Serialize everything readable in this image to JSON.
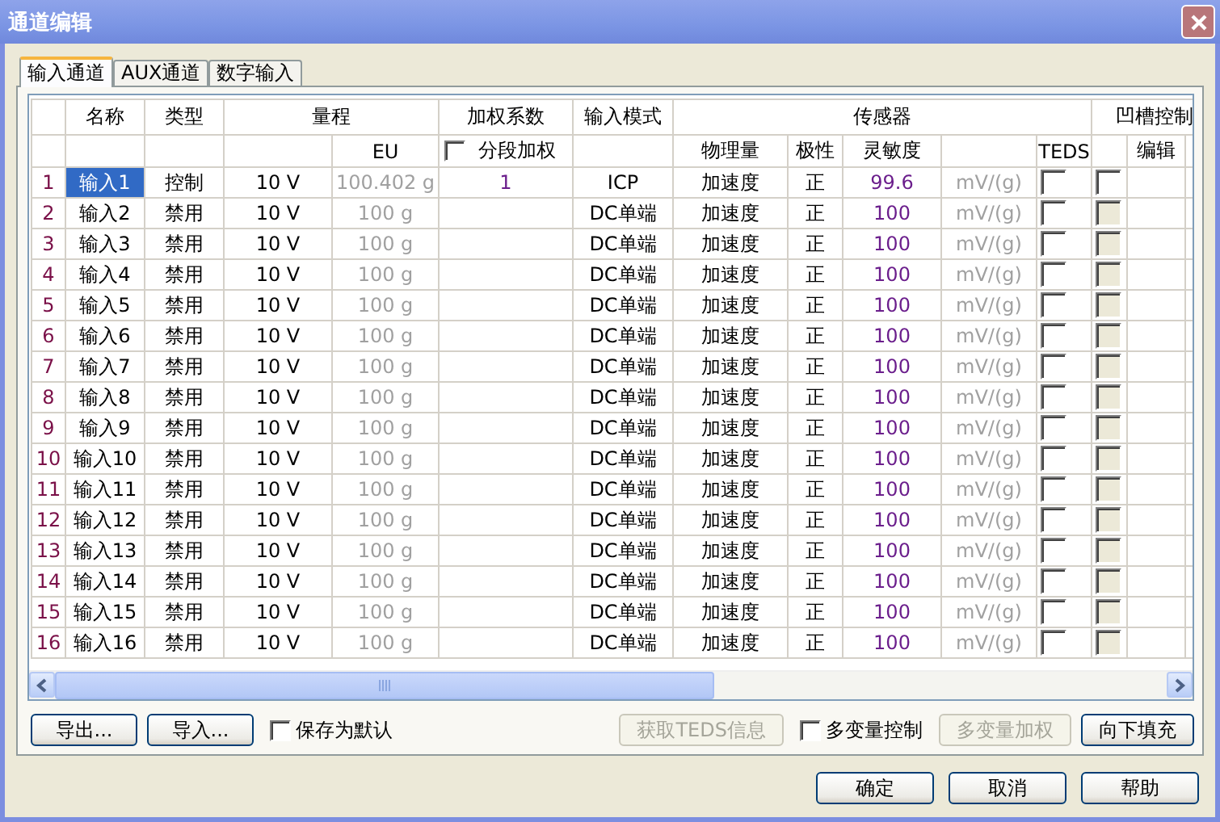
{
  "window": {
    "title": "通道编辑"
  },
  "tabs": [
    {
      "label": "输入通道",
      "selected": true
    },
    {
      "label": "AUX通道",
      "selected": false
    },
    {
      "label": "数字输入",
      "selected": false
    }
  ],
  "table": {
    "column_groups": [
      {
        "label": "名称",
        "subheaders": [
          {
            "kind": "blank"
          }
        ]
      },
      {
        "label": "类型",
        "subheaders": [
          {
            "kind": "blank"
          }
        ]
      },
      {
        "label": "量程",
        "subheaders": [
          {
            "kind": "blank"
          },
          {
            "kind": "text",
            "label": "EU"
          }
        ]
      },
      {
        "label": "加权系数",
        "subheaders": [
          {
            "kind": "checkbox",
            "label": "分段加权",
            "checked": false
          }
        ]
      },
      {
        "label": "输入模式",
        "subheaders": [
          {
            "kind": "blank"
          }
        ]
      },
      {
        "label": "传感器",
        "subheaders": [
          {
            "kind": "text",
            "label": "物理量"
          },
          {
            "kind": "text",
            "label": "极性"
          },
          {
            "kind": "text",
            "label": "灵敏度"
          },
          {
            "kind": "blank"
          },
          {
            "kind": "text",
            "label": "TEDS"
          }
        ]
      },
      {
        "label": "凹槽控制",
        "subheaders": [
          {
            "kind": "blank"
          },
          {
            "kind": "text",
            "label": "编辑"
          },
          {
            "kind": "blank"
          }
        ]
      }
    ],
    "rows": [
      {
        "number": "1",
        "name": "输入1",
        "selected": true,
        "type": "控制",
        "range": "10 V",
        "eu": "100.402 g",
        "weight": "1",
        "input_mode": "ICP",
        "quantity": "加速度",
        "polarity": "正",
        "sensitivity": "99.6",
        "unit": "mV/(g)",
        "teds_checked": false,
        "notch_checked": false,
        "notch_disabled": false
      },
      {
        "number": "2",
        "name": "输入2",
        "selected": false,
        "type": "禁用",
        "range": "10 V",
        "eu": "100 g",
        "input_mode": "DC单端",
        "quantity": "加速度",
        "polarity": "正",
        "sensitivity": "100",
        "unit": "mV/(g)",
        "teds_checked": false,
        "notch_checked": false,
        "notch_disabled": true
      },
      {
        "number": "3",
        "name": "输入3",
        "selected": false,
        "type": "禁用",
        "range": "10 V",
        "eu": "100 g",
        "input_mode": "DC单端",
        "quantity": "加速度",
        "polarity": "正",
        "sensitivity": "100",
        "unit": "mV/(g)",
        "teds_checked": false,
        "notch_checked": false,
        "notch_disabled": true
      },
      {
        "number": "4",
        "name": "输入4",
        "selected": false,
        "type": "禁用",
        "range": "10 V",
        "eu": "100 g",
        "input_mode": "DC单端",
        "quantity": "加速度",
        "polarity": "正",
        "sensitivity": "100",
        "unit": "mV/(g)",
        "teds_checked": false,
        "notch_checked": false,
        "notch_disabled": true
      },
      {
        "number": "5",
        "name": "输入5",
        "selected": false,
        "type": "禁用",
        "range": "10 V",
        "eu": "100 g",
        "input_mode": "DC单端",
        "quantity": "加速度",
        "polarity": "正",
        "sensitivity": "100",
        "unit": "mV/(g)",
        "teds_checked": false,
        "notch_checked": false,
        "notch_disabled": true
      },
      {
        "number": "6",
        "name": "输入6",
        "selected": false,
        "type": "禁用",
        "range": "10 V",
        "eu": "100 g",
        "input_mode": "DC单端",
        "quantity": "加速度",
        "polarity": "正",
        "sensitivity": "100",
        "unit": "mV/(g)",
        "teds_checked": false,
        "notch_checked": false,
        "notch_disabled": true
      },
      {
        "number": "7",
        "name": "输入7",
        "selected": false,
        "type": "禁用",
        "range": "10 V",
        "eu": "100 g",
        "input_mode": "DC单端",
        "quantity": "加速度",
        "polarity": "正",
        "sensitivity": "100",
        "unit": "mV/(g)",
        "teds_checked": false,
        "notch_checked": false,
        "notch_disabled": true
      },
      {
        "number": "8",
        "name": "输入8",
        "selected": false,
        "type": "禁用",
        "range": "10 V",
        "eu": "100 g",
        "input_mode": "DC单端",
        "quantity": "加速度",
        "polarity": "正",
        "sensitivity": "100",
        "unit": "mV/(g)",
        "teds_checked": false,
        "notch_checked": false,
        "notch_disabled": true
      },
      {
        "number": "9",
        "name": "输入9",
        "selected": false,
        "type": "禁用",
        "range": "10 V",
        "eu": "100 g",
        "input_mode": "DC单端",
        "quantity": "加速度",
        "polarity": "正",
        "sensitivity": "100",
        "unit": "mV/(g)",
        "teds_checked": false,
        "notch_checked": false,
        "notch_disabled": true
      },
      {
        "number": "10",
        "name": "输入10",
        "selected": false,
        "type": "禁用",
        "range": "10 V",
        "eu": "100 g",
        "input_mode": "DC单端",
        "quantity": "加速度",
        "polarity": "正",
        "sensitivity": "100",
        "unit": "mV/(g)",
        "teds_checked": false,
        "notch_checked": false,
        "notch_disabled": true
      },
      {
        "number": "11",
        "name": "输入11",
        "selected": false,
        "type": "禁用",
        "range": "10 V",
        "eu": "100 g",
        "input_mode": "DC单端",
        "quantity": "加速度",
        "polarity": "正",
        "sensitivity": "100",
        "unit": "mV/(g)",
        "teds_checked": false,
        "notch_checked": false,
        "notch_disabled": true
      },
      {
        "number": "12",
        "name": "输入12",
        "selected": false,
        "type": "禁用",
        "range": "10 V",
        "eu": "100 g",
        "input_mode": "DC单端",
        "quantity": "加速度",
        "polarity": "正",
        "sensitivity": "100",
        "unit": "mV/(g)",
        "teds_checked": false,
        "notch_checked": false,
        "notch_disabled": true
      },
      {
        "number": "13",
        "name": "输入13",
        "selected": false,
        "type": "禁用",
        "range": "10 V",
        "eu": "100 g",
        "input_mode": "DC单端",
        "quantity": "加速度",
        "polarity": "正",
        "sensitivity": "100",
        "unit": "mV/(g)",
        "teds_checked": false,
        "notch_checked": false,
        "notch_disabled": true
      },
      {
        "number": "14",
        "name": "输入14",
        "selected": false,
        "type": "禁用",
        "range": "10 V",
        "eu": "100 g",
        "input_mode": "DC单端",
        "quantity": "加速度",
        "polarity": "正",
        "sensitivity": "100",
        "unit": "mV/(g)",
        "teds_checked": false,
        "notch_checked": false,
        "notch_disabled": true
      },
      {
        "number": "15",
        "name": "输入15",
        "selected": false,
        "type": "禁用",
        "range": "10 V",
        "eu": "100 g",
        "input_mode": "DC单端",
        "quantity": "加速度",
        "polarity": "正",
        "sensitivity": "100",
        "unit": "mV/(g)",
        "teds_checked": false,
        "notch_checked": false,
        "notch_disabled": true
      },
      {
        "number": "16",
        "name": "输入16",
        "selected": false,
        "type": "禁用",
        "range": "10 V",
        "eu": "100 g",
        "input_mode": "DC单端",
        "quantity": "加速度",
        "polarity": "正",
        "sensitivity": "100",
        "unit": "mV/(g)",
        "teds_checked": false,
        "notch_checked": false,
        "notch_disabled": true
      }
    ]
  },
  "actions": [
    {
      "kind": "button",
      "label": "导出...",
      "disabled": false
    },
    {
      "kind": "button",
      "label": "导入...",
      "disabled": false
    },
    {
      "kind": "checkbox",
      "label": "保存为默认",
      "checked": false
    },
    {
      "kind": "spacer"
    },
    {
      "kind": "button",
      "label": "获取TEDS信息",
      "disabled": true
    },
    {
      "kind": "checkbox",
      "label": "多变量控制",
      "checked": false
    },
    {
      "kind": "button",
      "label": "多变量加权",
      "disabled": true
    },
    {
      "kind": "button",
      "label": "向下填充",
      "disabled": false
    }
  ],
  "buttons": [
    "确定",
    "取消",
    "帮助"
  ]
}
